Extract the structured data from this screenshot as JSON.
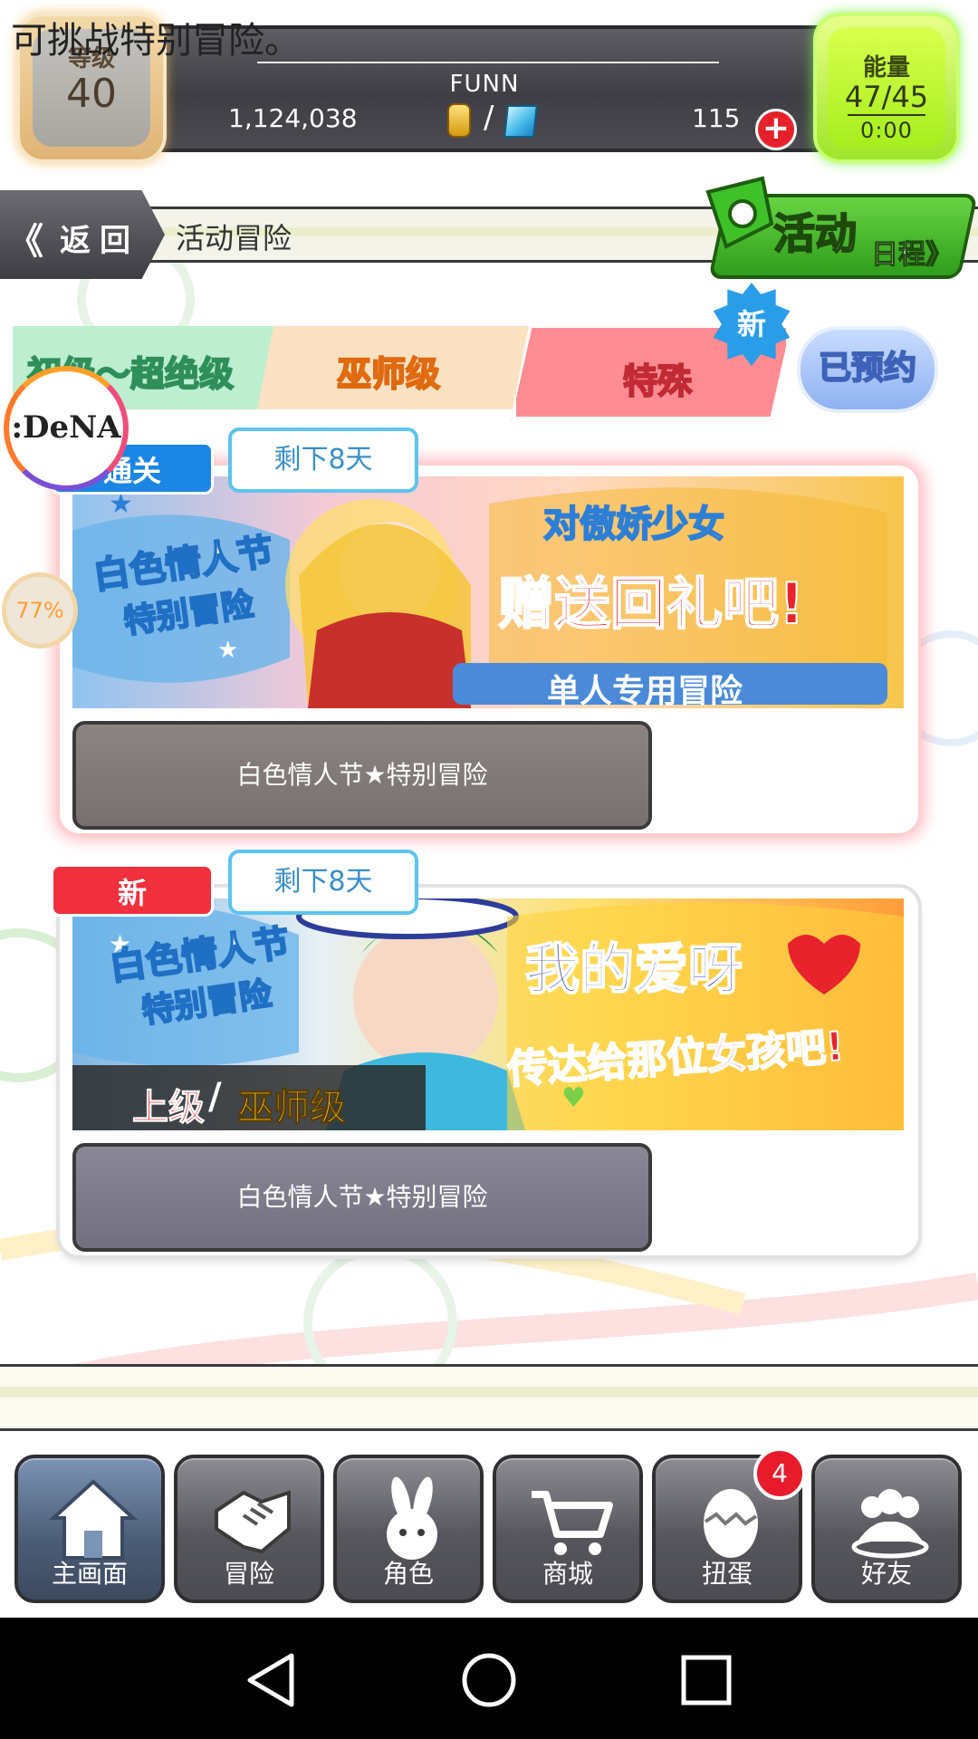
{
  "status": {
    "level_label": "等级",
    "level_value": "40",
    "player_name": "FUNN",
    "money": "1,124,038",
    "gems": "115",
    "energy_label": "能量",
    "energy_value": "47/45",
    "energy_timer": "0:00"
  },
  "nav": {
    "back_label": "返回",
    "breadcrumb": "活动冒险",
    "event_schedule_big": "活动",
    "event_schedule_small": "日程》"
  },
  "tabs": {
    "tab_1": "初级～超绝级",
    "tab_2": "巫师级",
    "tab_3": "特殊",
    "new_badge": "新",
    "reserved": "已预约"
  },
  "overlay": {
    "logo": ":DeNA",
    "progress": "77%"
  },
  "cards": [
    {
      "tag": "通关",
      "days_left": "剩下8天",
      "banner_left_1": "白色情人节",
      "banner_left_2": "特别冒险",
      "banner_title_1": "对傲娇少女",
      "banner_title_2": "赠送回礼吧!",
      "banner_title_3": "单人专用冒险",
      "button": "白色情人节★特别冒险"
    },
    {
      "tag": "新",
      "days_left": "剩下8天",
      "banner_left_1": "白色情人节",
      "banner_left_2": "特别冒险",
      "banner_difficulty_a": "上级",
      "banner_difficulty_sep": "/",
      "banner_difficulty_b": "巫师级",
      "banner_title_1": "我的爱呀",
      "banner_title_2": "传达给那位女孩吧!",
      "button": "白色情人节★特别冒险"
    }
  ],
  "message": "可挑战特别冒险。",
  "bottom_nav": [
    {
      "label": "主画面",
      "icon": "home-icon"
    },
    {
      "label": "冒险",
      "icon": "handshake-icon"
    },
    {
      "label": "角色",
      "icon": "rabbit-icon"
    },
    {
      "label": "商城",
      "icon": "cart-icon"
    },
    {
      "label": "扭蛋",
      "icon": "egg-icon",
      "badge": "4"
    },
    {
      "label": "好友",
      "icon": "friends-icon"
    }
  ],
  "colors": {
    "tab_special": "#ff8c92",
    "energy": "#a6ee1e",
    "card_new": "#f0303c",
    "card_clear": "#1c86e4"
  }
}
